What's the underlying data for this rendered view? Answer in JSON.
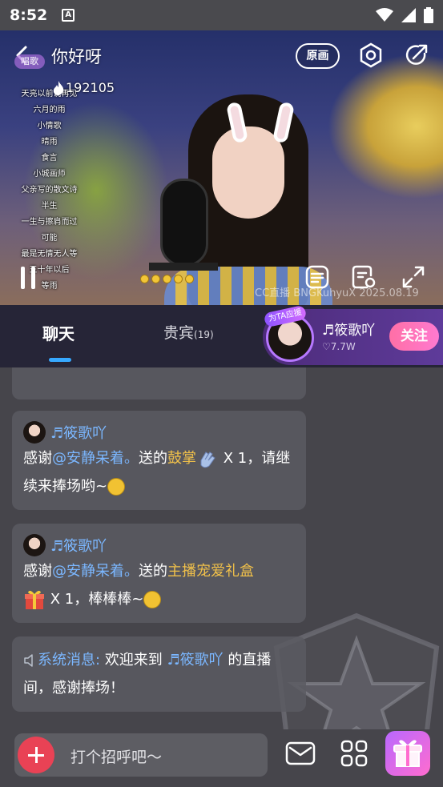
{
  "status_bar": {
    "time": "8:52",
    "notification_icon": "A"
  },
  "room": {
    "title": "你好呀",
    "tag": "唱歌",
    "viewer_count": "192105",
    "original_button": "原画",
    "watermark": "CC直播 BNGKuhyuX 2025.08.19"
  },
  "song_list": [
    "天亮以前说再见",
    "六月的雨",
    "小情歌",
    "晴雨",
    "食言",
    "小城画师",
    "父亲写的散文诗",
    "半生",
    "一生与擦肩而过",
    "可能",
    "最是无情无人等",
    "五十年以后",
    "等雨"
  ],
  "tabs": [
    {
      "label": "聊天",
      "active": true
    },
    {
      "label": "贵宾",
      "count": "(19)"
    }
  ],
  "anchor": {
    "badge": "为TA应援",
    "name": "♬筱歌吖",
    "likes": "♡7.7W",
    "follow_label": "关注"
  },
  "messages": [
    {
      "username": "♬筱歌吖",
      "prefix": "感谢",
      "mention": "@安静呆着。",
      "mid": "送的",
      "gift": "鼓掌",
      "suffix": " X 1，请继续来捧场哟~"
    },
    {
      "username": "♬筱歌吖",
      "prefix": "感谢",
      "mention": "@安静呆着。",
      "mid": "送的",
      "gift": "主播宠爱礼盒",
      "suffix": " X 1，棒棒棒~"
    }
  ],
  "system_message": {
    "label": "系统消息:",
    "text_before": "欢迎来到",
    "anchor": "♬筱歌吖",
    "text_after": "的直播间，感谢捧场！"
  },
  "bottom_bar": {
    "input_placeholder": "打个招呼吧～"
  },
  "colors": {
    "accent_blue": "#7bb7ff",
    "gift_gold": "#f0c04a",
    "follow_pink": "#ff6fa6",
    "plus_red": "#e94255"
  }
}
